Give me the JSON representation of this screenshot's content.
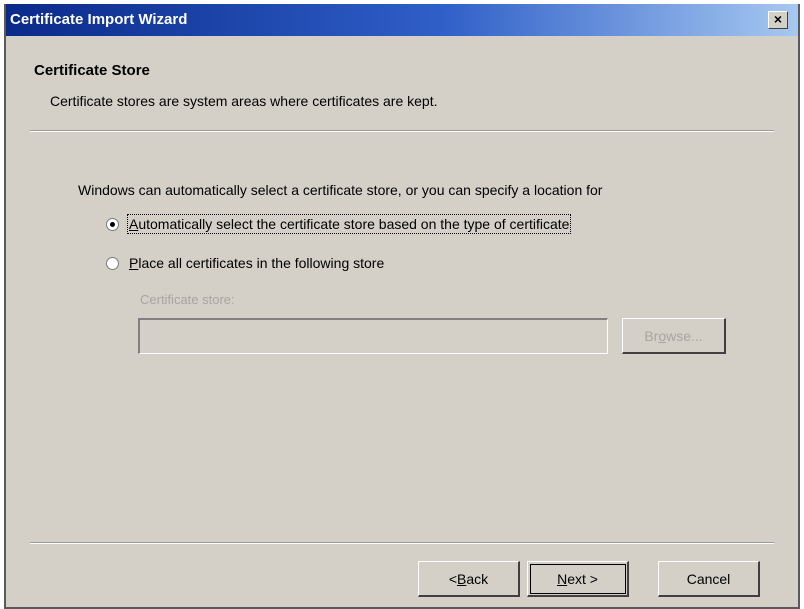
{
  "window": {
    "title": "Certificate Import Wizard",
    "close_glyph": "×"
  },
  "header": {
    "title": "Certificate Store",
    "description": "Certificate stores are system areas where certificates are kept."
  },
  "body": {
    "intro": "Windows can automatically select a certificate store, or you can specify a location for",
    "options": [
      {
        "accel": "A",
        "rest": "utomatically select the certificate store based on the type of certificate",
        "checked": true
      },
      {
        "accel": "P",
        "rest": "lace all certificates in the following store",
        "checked": false
      }
    ],
    "store_label": "Certificate store:",
    "store_value": "",
    "browse": {
      "pre": "Br",
      "accel": "o",
      "post": "wse...",
      "enabled": false
    }
  },
  "footer": {
    "back": {
      "prefix": "< ",
      "accel": "B",
      "rest": "ack"
    },
    "next": {
      "accel": "N",
      "rest": "ext >"
    },
    "cancel": "Cancel"
  }
}
